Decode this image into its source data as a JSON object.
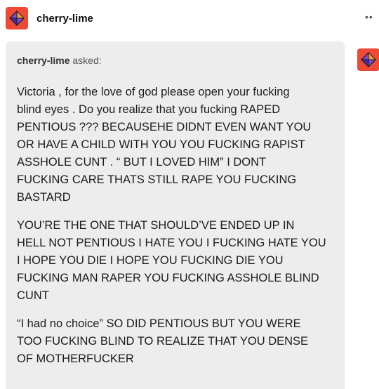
{
  "header": {
    "blog_name": "cherry-lime",
    "avatar_icon": "tumblr-avatar-octahedron-icon",
    "more_icon": "more-options-icon",
    "more_label": "••"
  },
  "ask": {
    "asker_name": "cherry-lime",
    "asked_label": "asked:",
    "paragraphs": [
      "Victoria , for the love of god please open your fucking\nblind eyes . Do you realize that you fucking RAPED\nPENTIOUS ??? BECAUSEHE DIDNT EVEN WANT YOU\nOR HAVE A CHILD WITH YOU YOU FUCKING RAPIST\nASSHOLE CUNT . “ BUT I LOVED HIM” I DONT\nFUCKING CARE THATS STILL RAPE YOU FUCKING\nBASTARD",
      "YOU’RE THE ONE THAT SHOULD’VE ENDED UP IN\nHELL NOT PENTIOUS I HATE YOU I FUCKING HATE YOU\nI HOPE YOU DIE I HOPE YOU FUCKING DIE YOU\nFUCKING MAN RAPER YOU FUCKING ASSHOLE BLIND\nCUNT",
      "“I had no choice” SO DID PENTIOUS BUT YOU WERE\nTOO FUCKING BLIND TO REALIZE THAT YOU DENSE\nOF MOTHERFUCKER"
    ]
  },
  "colors": {
    "avatar_bg": "#ef4a36",
    "avatar_shape": "#6a3fc4",
    "ask_bg": "#ededed"
  }
}
